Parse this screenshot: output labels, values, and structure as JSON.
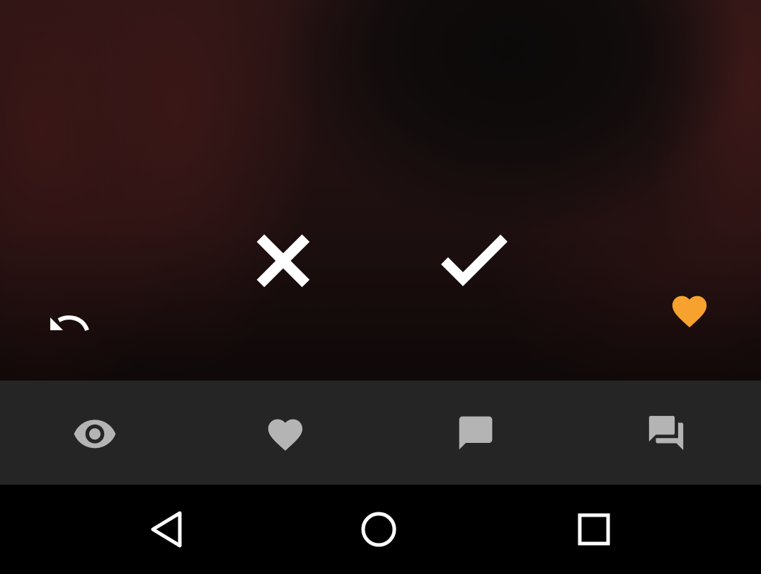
{
  "screen": {
    "photo": {
      "actions": {
        "undo": {
          "icon": "undo-icon",
          "color": "#ffffff"
        },
        "reject": {
          "icon": "close-icon",
          "color": "#ffffff"
        },
        "accept": {
          "icon": "check-icon",
          "color": "#ffffff"
        },
        "favorite": {
          "icon": "heart-icon",
          "color": "#f7a12f"
        }
      }
    },
    "tabbar": {
      "background": "#252525",
      "icon_color": "#b4b4b4",
      "tabs": [
        {
          "icon": "eye-icon"
        },
        {
          "icon": "heart-icon"
        },
        {
          "icon": "chat-bubble-icon"
        },
        {
          "icon": "forum-icon"
        }
      ]
    },
    "navbar": {
      "buttons": [
        {
          "icon": "back-triangle-icon"
        },
        {
          "icon": "home-circle-icon"
        },
        {
          "icon": "recents-square-icon"
        }
      ]
    }
  }
}
